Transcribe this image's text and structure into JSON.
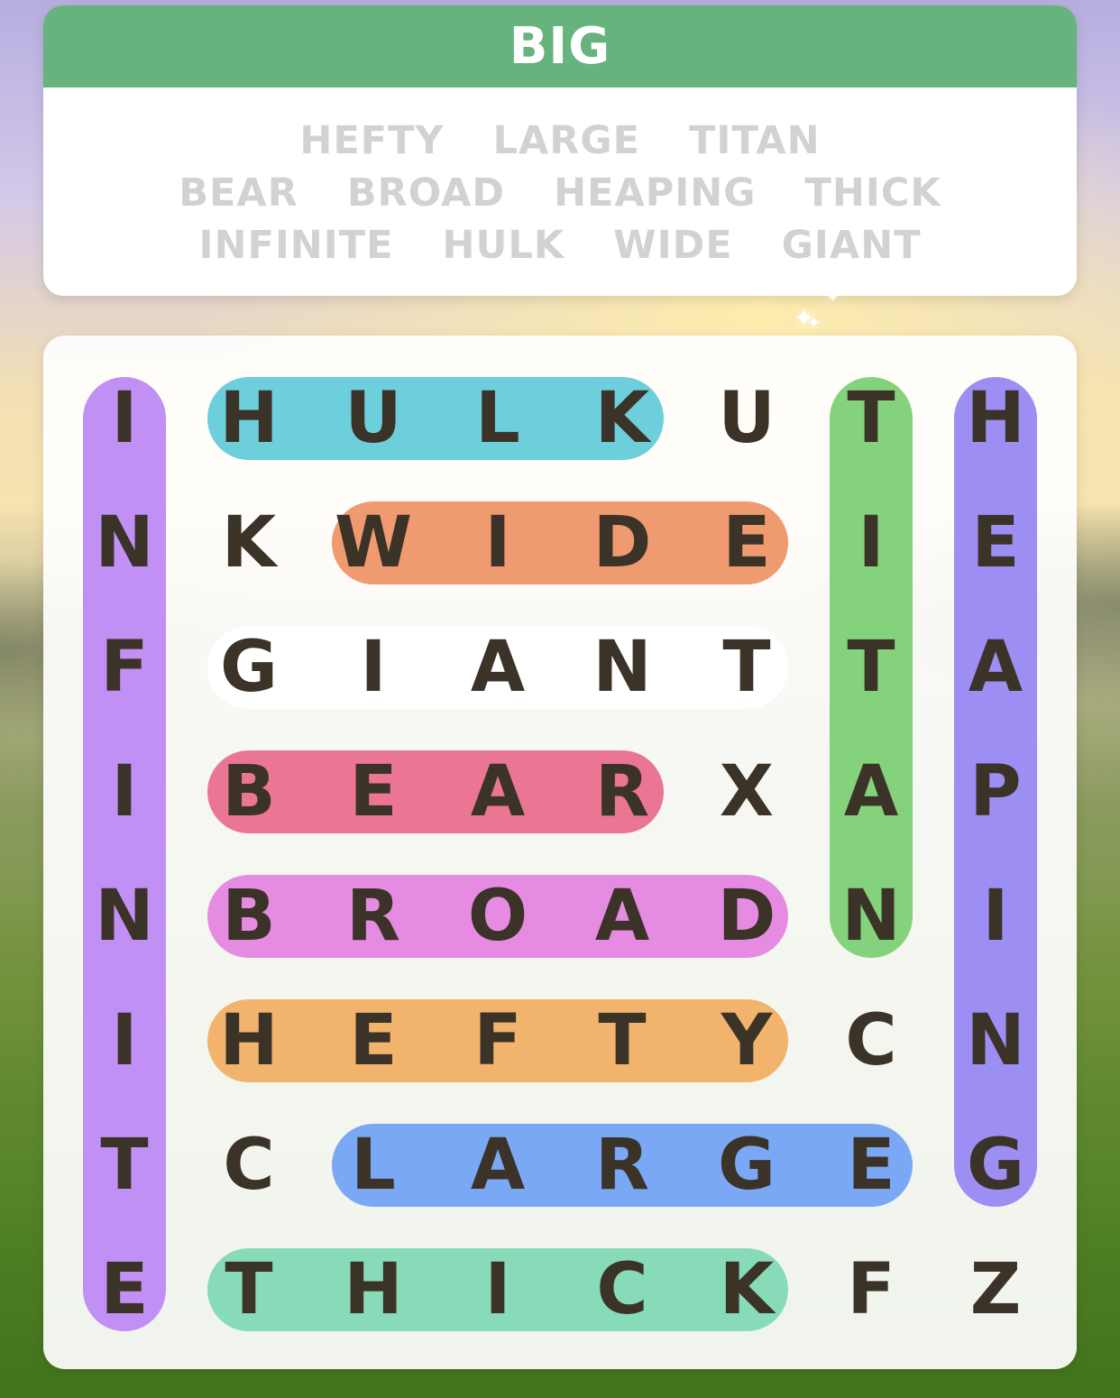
{
  "title": "BIG",
  "word_rows": [
    [
      "HEFTY",
      "LARGE",
      "TITAN"
    ],
    [
      "BEAR",
      "BROAD",
      "HEAPING",
      "THICK"
    ],
    [
      "INFINITE",
      "HULK",
      "WIDE",
      "GIANT"
    ]
  ],
  "grid": [
    [
      "I",
      "H",
      "U",
      "L",
      "K",
      "U",
      "T",
      "H"
    ],
    [
      "N",
      "K",
      "W",
      "I",
      "D",
      "E",
      "I",
      "E"
    ],
    [
      "F",
      "G",
      "I",
      "A",
      "N",
      "T",
      "T",
      "A"
    ],
    [
      "I",
      "B",
      "E",
      "A",
      "R",
      "X",
      "A",
      "P"
    ],
    [
      "N",
      "B",
      "R",
      "O",
      "A",
      "D",
      "N",
      "I"
    ],
    [
      "I",
      "H",
      "E",
      "F",
      "T",
      "Y",
      "C",
      "N"
    ],
    [
      "T",
      "C",
      "L",
      "A",
      "R",
      "G",
      "E",
      "G"
    ],
    [
      "E",
      "T",
      "H",
      "I",
      "C",
      "K",
      "F",
      "Z"
    ]
  ],
  "found_words": [
    {
      "word": "INFINITE",
      "dir": "v",
      "row": 0,
      "col": 0,
      "len": 8,
      "color": "#c190f5"
    },
    {
      "word": "HULK",
      "dir": "h",
      "row": 0,
      "col": 1,
      "len": 4,
      "color": "#6dcfdc"
    },
    {
      "word": "TITAN",
      "dir": "v",
      "row": 0,
      "col": 6,
      "len": 5,
      "color": "#85d27d"
    },
    {
      "word": "HEAPING",
      "dir": "v",
      "row": 0,
      "col": 7,
      "len": 7,
      "color": "#9d8ef3"
    },
    {
      "word": "WIDE",
      "dir": "h",
      "row": 1,
      "col": 2,
      "len": 4,
      "color": "#f09a70"
    },
    {
      "word": "GIANT",
      "dir": "h",
      "row": 2,
      "col": 1,
      "len": 5,
      "color": "#ffffff"
    },
    {
      "word": "BEAR",
      "dir": "h",
      "row": 3,
      "col": 1,
      "len": 4,
      "color": "#eb7694"
    },
    {
      "word": "BROAD",
      "dir": "h",
      "row": 4,
      "col": 1,
      "len": 5,
      "color": "#e58be1"
    },
    {
      "word": "HEFTY",
      "dir": "h",
      "row": 5,
      "col": 1,
      "len": 5,
      "color": "#f2b36c"
    },
    {
      "word": "LARGE",
      "dir": "h",
      "row": 6,
      "col": 2,
      "len": 5,
      "color": "#7ba8f4"
    },
    {
      "word": "THICK",
      "dir": "h",
      "row": 7,
      "col": 1,
      "len": 5,
      "color": "#88dbb8"
    }
  ]
}
